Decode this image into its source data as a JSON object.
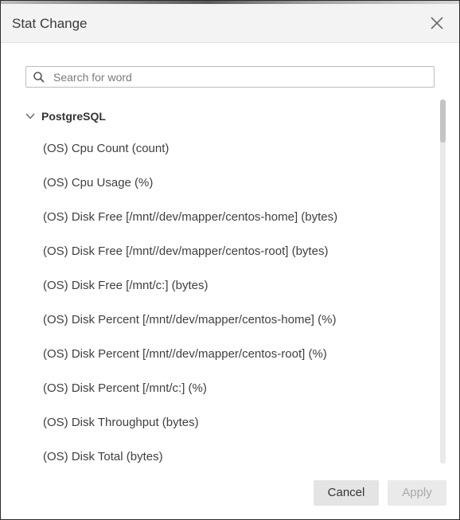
{
  "dialog": {
    "title": "Stat Change"
  },
  "search": {
    "placeholder": "Search for word",
    "value": ""
  },
  "group": {
    "label": "PostgreSQL",
    "expanded": true,
    "items": [
      {
        "label": "(OS) Cpu Count (count)"
      },
      {
        "label": "(OS) Cpu Usage (%)"
      },
      {
        "label": "(OS) Disk Free [/mnt//dev/mapper/centos-home] (bytes)"
      },
      {
        "label": "(OS) Disk Free [/mnt//dev/mapper/centos-root] (bytes)"
      },
      {
        "label": "(OS) Disk Free [/mnt/c:] (bytes)"
      },
      {
        "label": "(OS) Disk Percent [/mnt//dev/mapper/centos-home] (%)"
      },
      {
        "label": "(OS) Disk Percent [/mnt//dev/mapper/centos-root] (%)"
      },
      {
        "label": "(OS) Disk Percent [/mnt/c:] (%)"
      },
      {
        "label": "(OS) Disk Throughput (bytes)"
      },
      {
        "label": "(OS) Disk Total (bytes)"
      }
    ]
  },
  "footer": {
    "cancel_label": "Cancel",
    "apply_label": "Apply",
    "apply_enabled": false
  },
  "icons": {
    "close": "close-icon",
    "search": "search-icon",
    "chevron": "chevron-down-icon"
  }
}
